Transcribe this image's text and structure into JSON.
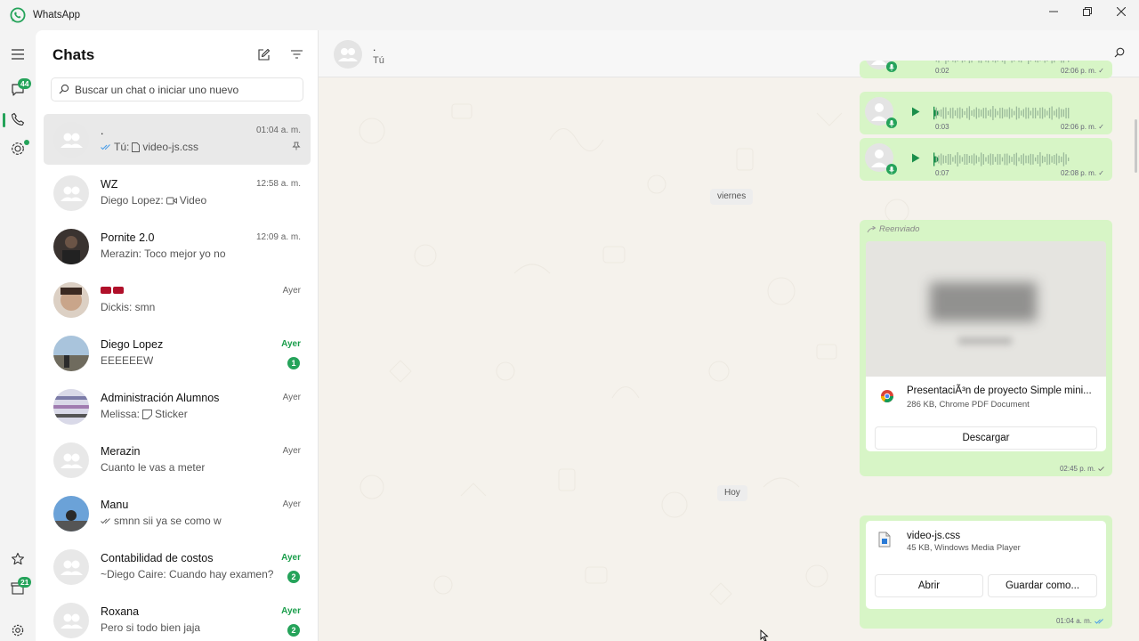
{
  "app": {
    "title": "WhatsApp",
    "brand_color": "#25a35a"
  },
  "rail": {
    "chats_badge": "44",
    "status_badge": "21",
    "icons": [
      "menu-icon",
      "chats-icon",
      "calls-icon",
      "status-icon",
      "starred-icon",
      "archive-icon",
      "settings-icon"
    ]
  },
  "chatlist": {
    "title": "Chats",
    "search_placeholder": "Buscar un chat o iniciar uno nuevo",
    "items": [
      {
        "name": ".",
        "preview_prefix": "Tú:",
        "preview": "video-js.css",
        "time": "01:04 a. m.",
        "unread": "",
        "pinned": true,
        "selected": true,
        "avatar": "default"
      },
      {
        "name": "WZ",
        "preview_prefix": "Diego Lopez:",
        "preview": "Video",
        "time": "12:58 a. m.",
        "unread": "",
        "avatar": "default"
      },
      {
        "name": "Pornite 2.0",
        "preview_prefix": "",
        "preview": "Merazin: Toco mejor yo no",
        "time": "12:09 a. m.",
        "unread": "",
        "avatar": "photo-dark"
      },
      {
        "name": "",
        "preview_prefix": "",
        "preview": "Dickis: smn",
        "time": "Ayer",
        "unread": "",
        "avatar": "photo-face"
      },
      {
        "name": "Diego Lopez",
        "preview_prefix": "",
        "preview": "EEEEEEW",
        "time": "Ayer",
        "unread": "1",
        "avatar": "photo-landscape"
      },
      {
        "name": "Administración Alumnos",
        "preview_prefix": "Melissa:",
        "preview": "Sticker",
        "time": "Ayer",
        "unread": "",
        "avatar": "photo-stripes"
      },
      {
        "name": "Merazin",
        "preview_prefix": "",
        "preview": "Cuanto le vas a meter",
        "time": "Ayer",
        "unread": "",
        "avatar": "default"
      },
      {
        "name": "Manu",
        "preview_prefix": "",
        "preview": "smnn sii ya se como w",
        "time": "Ayer",
        "unread": "",
        "avatar": "photo-sky"
      },
      {
        "name": "Contabilidad de costos",
        "preview_prefix": "",
        "preview": "~Diego Caire: Cuando hay examen?",
        "time": "Ayer",
        "unread": "2",
        "avatar": "default"
      },
      {
        "name": "Roxana",
        "preview_prefix": "",
        "preview": "Pero si todo bien jaja",
        "time": "Ayer",
        "unread": "2",
        "avatar": "default"
      }
    ]
  },
  "conversation": {
    "name": ".",
    "subtitle": "Tú",
    "voice_notes": [
      {
        "duration": "0:02",
        "time": "02:06 p. m."
      },
      {
        "duration": "0:03",
        "time": "02:06 p. m."
      },
      {
        "duration": "0:07",
        "time": "02:08 p. m."
      }
    ],
    "date_separators": [
      "viernes",
      "Hoy"
    ],
    "forwarded_doc": {
      "forwarded_label": "Reenviado",
      "file_name": "PresentaciÃ³n de proyecto Simple mini...",
      "file_meta": "286 KB, Chrome PDF Document",
      "button": "Descargar",
      "time": "02:45 p. m."
    },
    "css_doc": {
      "file_name": "video-js.css",
      "file_meta": "45 KB, Windows Media Player",
      "open_button": "Abrir",
      "save_button": "Guardar como...",
      "time": "01:04 a. m."
    }
  }
}
